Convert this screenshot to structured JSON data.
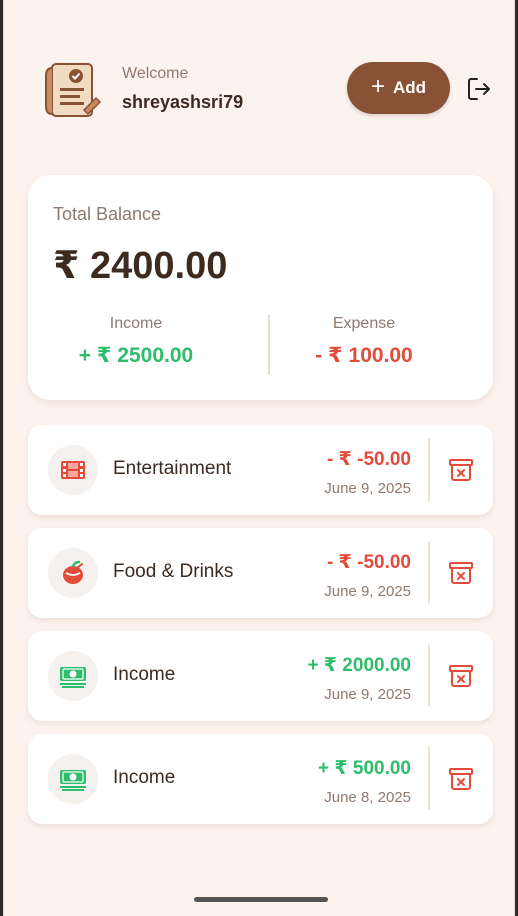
{
  "header": {
    "welcome_label": "Welcome",
    "username": "shreyashsri79",
    "add_label": "Add"
  },
  "balance": {
    "label": "Total Balance",
    "amount": "₹ 2400.00",
    "income_label": "Income",
    "income_value": "+ ₹ 2500.00",
    "expense_label": "Expense",
    "expense_value": "- ₹ 100.00"
  },
  "transactions": [
    {
      "category": "Entertainment",
      "amount": "- ₹ -50.00",
      "date": "June 9, 2025",
      "type": "expense",
      "icon": "film-icon"
    },
    {
      "category": "Food & Drinks",
      "amount": "- ₹ -50.00",
      "date": "June 9, 2025",
      "type": "expense",
      "icon": "food-icon"
    },
    {
      "category": "Income",
      "amount": "+ ₹ 2000.00",
      "date": "June 9, 2025",
      "type": "income",
      "icon": "cash-icon"
    },
    {
      "category": "Income",
      "amount": "+ ₹ 500.00",
      "date": "June 8, 2025",
      "type": "income",
      "icon": "cash-icon"
    }
  ],
  "colors": {
    "background": "#fdf3ee",
    "accent": "#8a5235",
    "income": "#2ebd6b",
    "expense": "#e34b3a",
    "text_dark": "#3d2a20",
    "text_muted": "#8e7a6e"
  }
}
